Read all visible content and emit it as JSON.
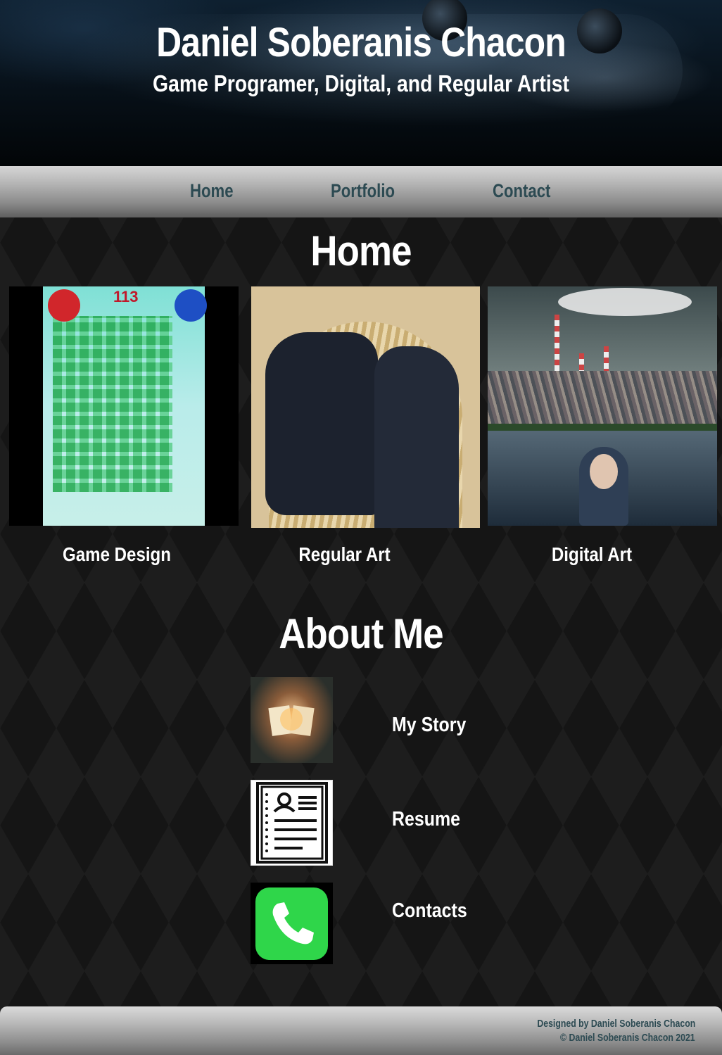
{
  "header": {
    "name": "Daniel Soberanis Chacon",
    "tagline": "Game Programer, Digital, and Regular Artist"
  },
  "nav": {
    "items": [
      {
        "label": "Home"
      },
      {
        "label": "Portfolio"
      },
      {
        "label": "Contact"
      }
    ]
  },
  "home": {
    "title": "Home",
    "cards": [
      {
        "label": "Game Design",
        "image": "game-design-thumbnail",
        "score": "113"
      },
      {
        "label": "Regular Art",
        "image": "regular-art-thumbnail"
      },
      {
        "label": "Digital Art",
        "image": "digital-art-thumbnail"
      }
    ]
  },
  "about": {
    "title": "About Me",
    "items": [
      {
        "label": "My Story",
        "icon": "open-book-icon"
      },
      {
        "label": "Resume",
        "icon": "resume-document-icon"
      },
      {
        "label": "Contacts",
        "icon": "phone-icon"
      }
    ]
  },
  "footer": {
    "designed_by": "Designed by Daniel Soberanis Chacon",
    "copyright": "© Daniel Soberanis Chacon 2021"
  },
  "colors": {
    "nav_text": "#2c4a52",
    "background": "#151515",
    "phone_green": "#2fd64a"
  }
}
